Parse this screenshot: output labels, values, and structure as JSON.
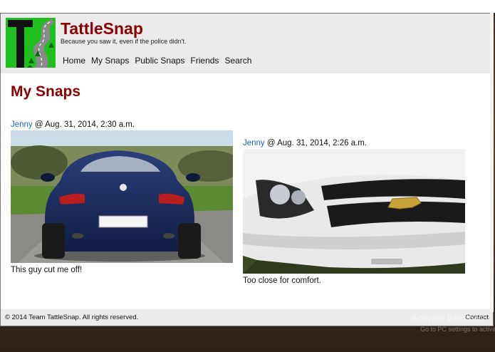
{
  "brand": {
    "title": "TattleSnap",
    "tagline": "Because you saw it, even if the police didn't."
  },
  "nav": [
    "Home",
    "My Snaps",
    "Public Snaps",
    "Friends",
    "Search"
  ],
  "page_title": "My Snaps",
  "snaps": [
    {
      "user": "Jenny",
      "timestamp": " @ Aug. 31, 2014, 2:30 a.m.",
      "caption": "This guy cut me off!",
      "image": "blue-sports-car-rear-photo"
    },
    {
      "user": "Jenny",
      "timestamp": " @ Aug. 31, 2014, 2:26 a.m.",
      "caption": "Too close for comfort.",
      "image": "white-truck-front-photo"
    }
  ],
  "footer": {
    "copyright": "© 2014 Team TattleSnap. All rights reserved.",
    "contact": "Contact"
  },
  "watermark": {
    "line1": "Activate Windows",
    "line2": "Go to PC settings to activate"
  },
  "colors": {
    "brand": "#8b0000",
    "link": "#1a63c9",
    "header_bg": "#ebebeb",
    "logo_bg": "#1fbf1f"
  }
}
